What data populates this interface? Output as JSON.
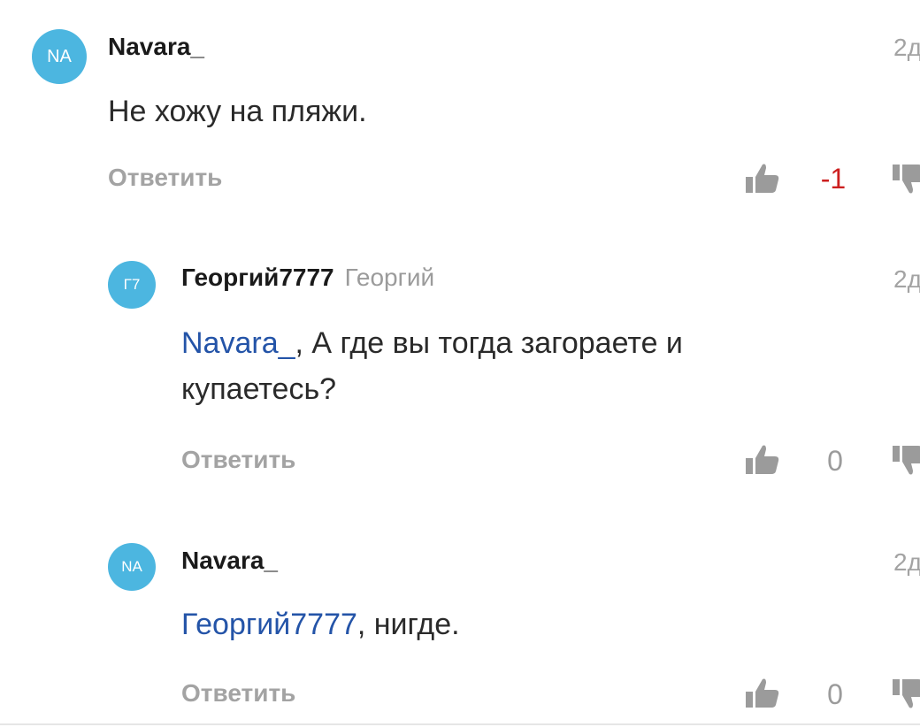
{
  "comments": [
    {
      "avatar_initials": "NA",
      "author": "Navara_",
      "real_name": "",
      "date": "2д",
      "mention": "",
      "text": "Не хожу на пляжи.",
      "text_line2": "",
      "reply_label": "Ответить",
      "score": "-1"
    },
    {
      "avatar_initials": "Г7",
      "author": "Георгий7777",
      "real_name": "Георгий",
      "date": "2д",
      "mention": "Navara_",
      "text": ", А где вы тогда загораете и",
      "text_line2": "купаетесь?",
      "reply_label": "Ответить",
      "score": "0"
    },
    {
      "avatar_initials": "NA",
      "author": "Navara_",
      "real_name": "",
      "date": "2д",
      "mention": "Георгий7777",
      "text": ", нигде.",
      "text_line2": "",
      "reply_label": "Ответить",
      "score": "0"
    }
  ],
  "colors": {
    "avatar": "#4cb6e0",
    "mention": "#2454a8",
    "negative_score": "#cc1f1f",
    "neutral_score": "#9b9b9b",
    "muted": "#a3a3a3"
  },
  "icons": {
    "like": "thumbs-up-icon",
    "dislike": "thumbs-down-icon"
  }
}
